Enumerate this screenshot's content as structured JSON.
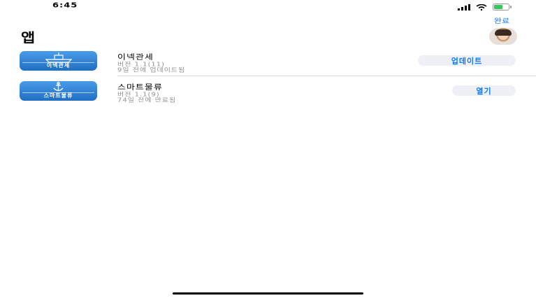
{
  "status_bar": {
    "time": "6:45"
  },
  "header": {
    "done_label": "완료",
    "title": "앱"
  },
  "apps": [
    {
      "name": "이넥관세",
      "icon_label": "이넥관세",
      "version": "버전 1.1(11)",
      "date": "9일 전에 업데이트됨",
      "action": "업데이트"
    },
    {
      "name": "스마트물류",
      "icon_label": "스마트물류",
      "version": "버전 1.1(9)",
      "date": "74일 전에 만료됨",
      "action": "열기"
    }
  ],
  "colors": {
    "accent": "#0a7aff",
    "icon_blue": "#1f6fc4",
    "pill_bg": "#eef0f6"
  }
}
